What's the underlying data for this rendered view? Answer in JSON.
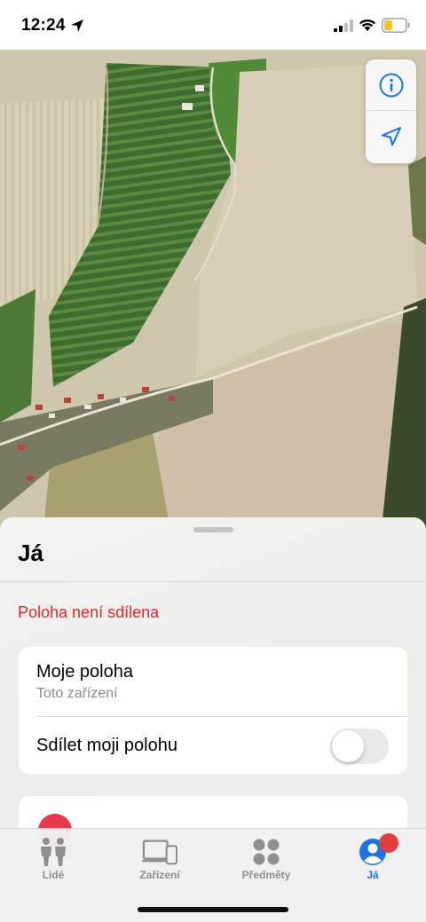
{
  "status_bar": {
    "time": "12:24",
    "icons": [
      "location-arrow-icon",
      "signal-icon",
      "wifi-icon",
      "battery-icon"
    ]
  },
  "map": {
    "view": "satellite",
    "controls": [
      "info-icon",
      "locate-arrow-icon"
    ],
    "colors": {
      "control_blue": "#1a73e8"
    }
  },
  "sheet": {
    "title": "Já",
    "not_shared": "Poloha není sdílena",
    "my_location": {
      "title": "Moje poloha",
      "subtitle": "Toto zařízení"
    },
    "share_label": "Sdílet moji polohu",
    "share_enabled": false
  },
  "tabs": [
    {
      "label": "Lidé",
      "icon": "people-icon",
      "active": false
    },
    {
      "label": "Zařízení",
      "icon": "devices-icon",
      "active": false
    },
    {
      "label": "Předměty",
      "icon": "items-icon",
      "active": false
    },
    {
      "label": "Já",
      "icon": "me-icon",
      "active": true,
      "badge": true
    }
  ],
  "colors": {
    "accent": "#1a73e8",
    "alert": "#e3262b",
    "tab_inactive": "#8e8e93"
  }
}
